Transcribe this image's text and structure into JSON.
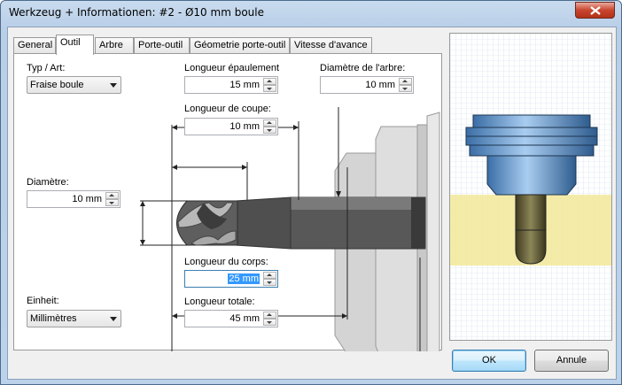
{
  "window": {
    "title": "Werkzeug + Informationen: #2 - Ø10 mm boule"
  },
  "tabs": [
    {
      "label": "General"
    },
    {
      "label": "Outil"
    },
    {
      "label": "Arbre"
    },
    {
      "label": "Porte-outil"
    },
    {
      "label": "Géometrie porte-outil"
    },
    {
      "label": "Vitesse d'avance"
    }
  ],
  "form": {
    "type_label": "Typ / Art:",
    "type_value": "Fraise boule",
    "shoulder_length_label": "Longueur épaulement",
    "shoulder_length_value": "15 mm",
    "shaft_diameter_label": "Diamètre de l'arbre:",
    "shaft_diameter_value": "10 mm",
    "cutting_length_label": "Longueur de coupe:",
    "cutting_length_value": "10 mm",
    "diameter_label": "Diamètre:",
    "diameter_value": "10 mm",
    "body_length_label": "Longueur du corps:",
    "body_length_value": "25 mm",
    "total_length_label": "Longueur totale:",
    "total_length_value": "45 mm",
    "unit_label": "Einheit:",
    "unit_value": "Millimètres"
  },
  "buttons": {
    "ok": "OK",
    "cancel": "Annule"
  },
  "colors": {
    "tool_body": "#5a5a5a",
    "holder": "#d6d6d6",
    "preview_stock": "#f3e9a0",
    "preview_holder": "#6a9ccf"
  }
}
